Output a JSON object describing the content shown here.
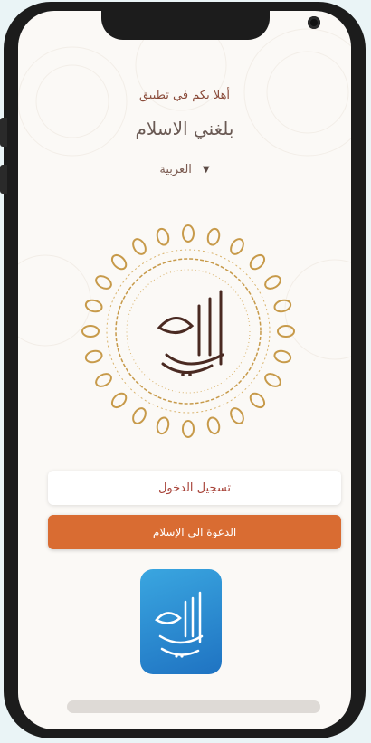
{
  "welcome": {
    "greeting": "أهلا بكم في تطبيق",
    "app_name": "بلغني الاسلام"
  },
  "language": {
    "selected": "العربية",
    "caret_icon": "chevron-down-icon"
  },
  "emblem": {
    "icon": "calligraphy-emblem",
    "accent": "#c79a4a",
    "text_color": "#4a2a22"
  },
  "buttons": {
    "login_label": "تسجيل الدخول",
    "dawah_label": "الدعوة الى الإسلام"
  },
  "app_icon": {
    "icon": "app-logo-calligraphy",
    "color": "#1f73c2"
  },
  "colors": {
    "greeting": "#8a4b3a",
    "primary": "#d96c32",
    "background": "#fbf9f6"
  }
}
